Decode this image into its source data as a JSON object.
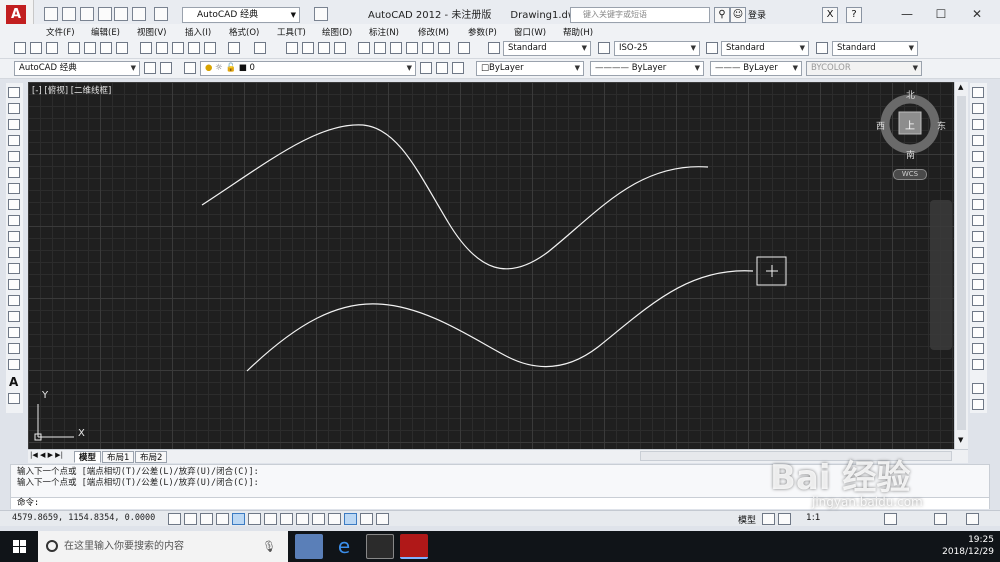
{
  "window": {
    "title": "AutoCAD 2012 - 未注册版",
    "document": "Drawing1.dwg",
    "workspace": "AutoCAD 经典",
    "search_placeholder": "键入关键字或短语",
    "login": "登录"
  },
  "menu": [
    "文件(F)",
    "编辑(E)",
    "视图(V)",
    "插入(I)",
    "格式(O)",
    "工具(T)",
    "绘图(D)",
    "标注(N)",
    "修改(M)",
    "参数(P)",
    "窗口(W)",
    "帮助(H)"
  ],
  "styles_toolbar": {
    "text_style": "Standard",
    "dim_style": "ISO-25",
    "table_style": "Standard",
    "mleader_style": "Standard"
  },
  "layers_toolbar": {
    "workspace": "AutoCAD 经典",
    "layer": "0",
    "color": "ByLayer",
    "linetype": "ByLayer",
    "lineweight": "ByLayer",
    "plotstyle": "BYCOLOR"
  },
  "viewport": {
    "label": "[-] [俯视] [二维线框]",
    "compass": {
      "north": "北",
      "south": "南",
      "east": "东",
      "west": "西",
      "top": "上"
    },
    "wcs": "WCS",
    "ucs_y": "Y",
    "ucs_x": "X"
  },
  "layout_tabs": [
    "模型",
    "布局1",
    "布局2"
  ],
  "command_line": {
    "history": [
      "输入下一个点或 [端点相切(T)/公差(L)/放弃(U)/闭合(C)]:",
      "输入下一个点或 [端点相切(T)/公差(L)/放弃(U)/闭合(C)]:"
    ],
    "prompt": "命令:"
  },
  "status": {
    "coordinates": "4579.8659, 1154.8354, 0.0000",
    "model": "模型",
    "scale": "1:1"
  },
  "taskbar": {
    "search_placeholder": "在这里输入你要搜索的内容",
    "time": "19:25",
    "date": "2018/12/29"
  },
  "watermark": {
    "text": "Bai 经验",
    "url": "jingyan.baidu.com"
  },
  "colors": {
    "canvas_bg": "#1f1f1f",
    "accent": "#c21f1f",
    "taskbar": "#101418"
  }
}
